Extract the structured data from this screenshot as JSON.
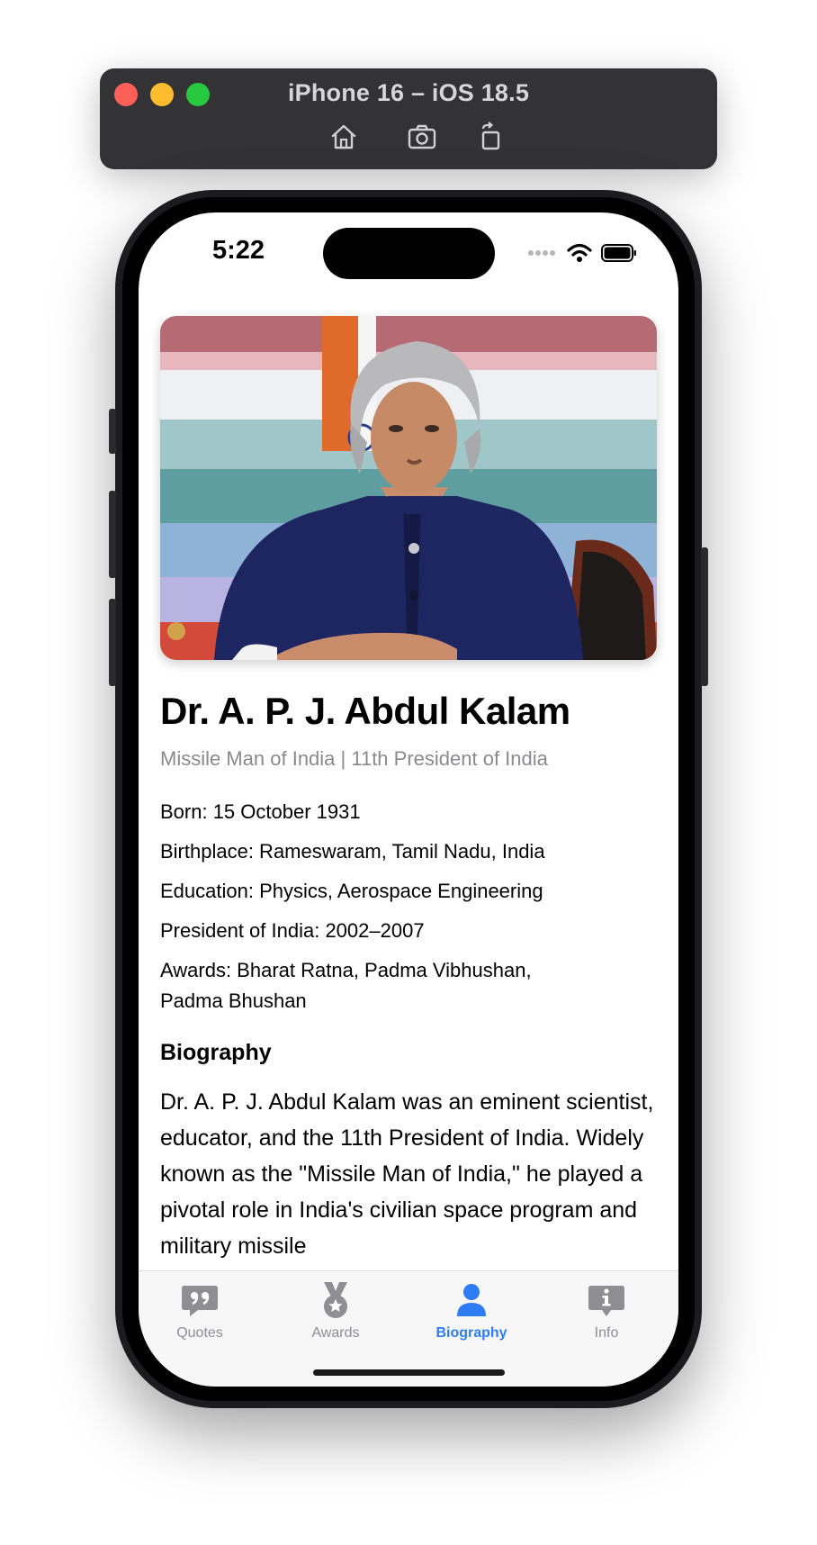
{
  "simulator": {
    "title": "iPhone 16 – iOS 18.5",
    "toolbar": [
      "home-icon",
      "screenshot-icon",
      "rotate-icon"
    ]
  },
  "status_bar": {
    "time": "5:22"
  },
  "profile": {
    "name": "Dr. A. P. J. Abdul Kalam",
    "subtitle": "Missile Man of India | 11th President of India",
    "facts": [
      "Born: 15 October 1931",
      "Birthplace: Rameswaram, Tamil Nadu, India",
      "Education: Physics, Aerospace Engineering",
      "President of India: 2002–2007",
      "Awards: Bharat Ratna, Padma Vibhushan, Padma Bhushan"
    ],
    "biography_heading": "Biography",
    "biography_text": "Dr. A. P. J. Abdul Kalam was an eminent scientist, educator, and the 11th President of India. Widely known as the \"Missile Man of India,\" he played a pivotal role in India's civilian space program and military missile"
  },
  "tabbar": {
    "tabs": [
      {
        "label": "Quotes",
        "icon": "quote-bubble-icon",
        "active": false
      },
      {
        "label": "Awards",
        "icon": "medal-icon",
        "active": false
      },
      {
        "label": "Biography",
        "icon": "person-icon",
        "active": true
      },
      {
        "label": "Info",
        "icon": "info-bubble-icon",
        "active": false
      }
    ]
  },
  "colors": {
    "accent": "#2e7cf6",
    "inactive": "#8e8e93",
    "subtitle": "#8a8a8e"
  }
}
